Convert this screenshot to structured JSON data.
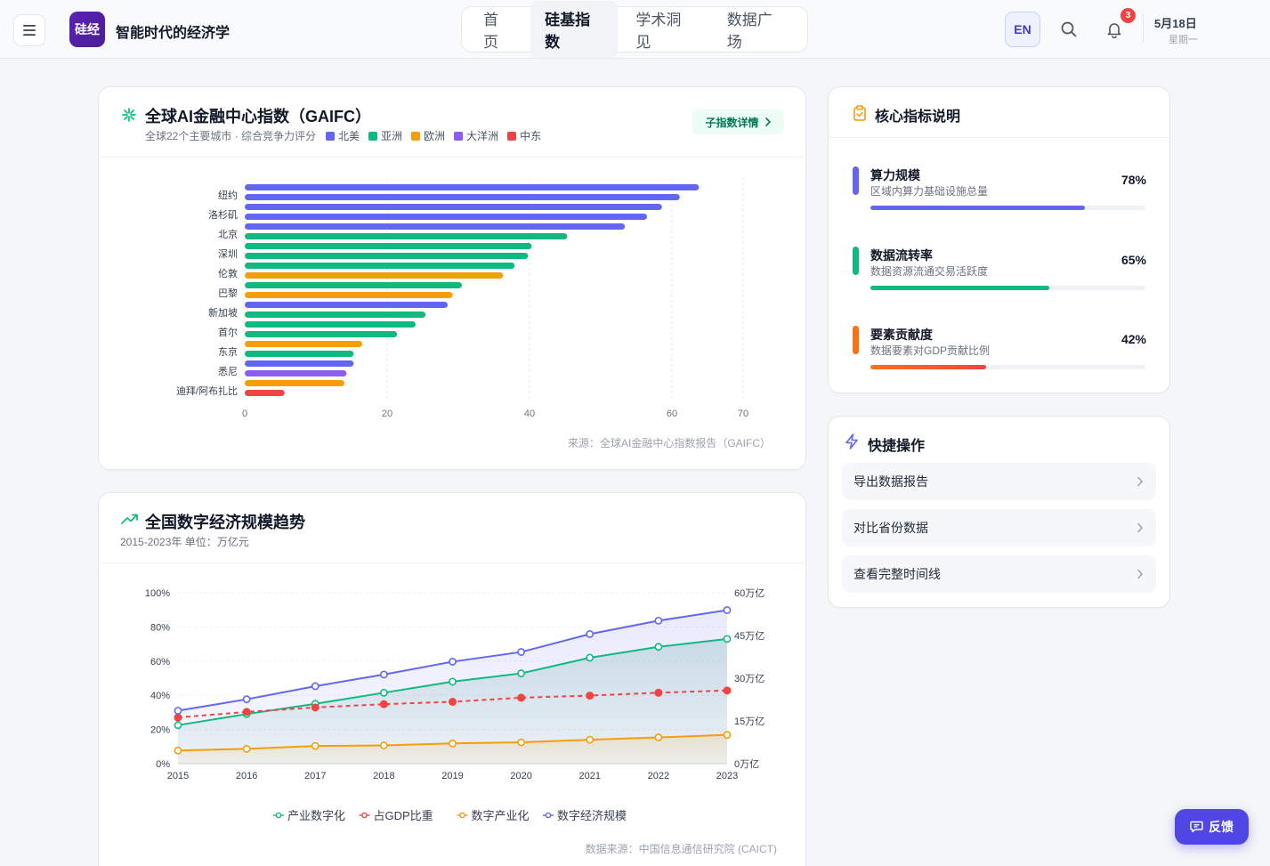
{
  "header": {
    "logo_text": "硅经",
    "site_title": "智能时代的经济学",
    "nav": [
      {
        "label": "首页",
        "active": false
      },
      {
        "label": "硅基指数",
        "active": true
      },
      {
        "label": "学术洞见",
        "active": false
      },
      {
        "label": "数据广场",
        "active": false
      }
    ],
    "lang_label": "EN",
    "notification_count": "3",
    "date": "5月18日",
    "weekday": "星期一"
  },
  "gaifc": {
    "title": "全球AI金融中心指数（GAIFC）",
    "subtitle": "全球22个主要城市 · 综合竞争力评分",
    "detail_button": "子指数详情",
    "source": "来源：全球AI金融中心指数报告（GAIFC）",
    "regions": [
      {
        "name": "北美",
        "color": "#6366f1"
      },
      {
        "name": "亚洲",
        "color": "#10b981"
      },
      {
        "name": "欧洲",
        "color": "#f59e0b"
      },
      {
        "name": "大洋洲",
        "color": "#8b5cf6"
      },
      {
        "name": "中东",
        "color": "#ef4444"
      }
    ]
  },
  "digital": {
    "title": "全国数字经济规模趋势",
    "subtitle": "2015-2023年 单位：万亿元",
    "source": "数据来源：中国信息通信研究院 (CAICT)"
  },
  "chart_data": [
    {
      "type": "bar",
      "orientation": "horizontal",
      "tick_labels_y": [
        "纽约",
        "洛杉矶",
        "北京",
        "深圳",
        "伦敦",
        "巴黎",
        "新加坡",
        "首尔",
        "东京",
        "悉尼",
        "迪拜/阿布扎比"
      ],
      "xlim": [
        0,
        70
      ],
      "xticks": [
        0,
        20,
        40,
        60,
        70
      ],
      "bars": [
        {
          "region": "北美",
          "value": 63.8
        },
        {
          "region": "北美",
          "value": 61.1
        },
        {
          "region": "北美",
          "value": 58.6
        },
        {
          "region": "北美",
          "value": 56.5
        },
        {
          "region": "北美",
          "value": 53.4
        },
        {
          "region": "亚洲",
          "value": 45.3
        },
        {
          "region": "亚洲",
          "value": 40.3
        },
        {
          "region": "亚洲",
          "value": 39.8
        },
        {
          "region": "亚洲",
          "value": 37.9
        },
        {
          "region": "欧洲",
          "value": 36.3
        },
        {
          "region": "亚洲",
          "value": 30.5
        },
        {
          "region": "欧洲",
          "value": 29.2
        },
        {
          "region": "北美",
          "value": 28.5
        },
        {
          "region": "亚洲",
          "value": 25.4
        },
        {
          "region": "亚洲",
          "value": 24.0
        },
        {
          "region": "亚洲",
          "value": 21.4
        },
        {
          "region": "欧洲",
          "value": 16.5
        },
        {
          "region": "亚洲",
          "value": 15.3
        },
        {
          "region": "北美",
          "value": 15.3
        },
        {
          "region": "大洋洲",
          "value": 14.3
        },
        {
          "region": "欧洲",
          "value": 14.0
        },
        {
          "region": "中东",
          "value": 5.6
        }
      ],
      "grid": "vertical dashed"
    },
    {
      "type": "line",
      "x": [
        "2015",
        "2016",
        "2017",
        "2018",
        "2019",
        "2020",
        "2021",
        "2022",
        "2023"
      ],
      "y_left_ticks": [
        "0%",
        "20%",
        "40%",
        "60%",
        "80%",
        "100%"
      ],
      "y_right_ticks": [
        "0万亿",
        "15万亿",
        "30万亿",
        "45万亿",
        "60万亿"
      ],
      "series": [
        {
          "name": "产业数字化",
          "axis": "right",
          "color": "#10b981",
          "values": [
            13.5,
            17.4,
            21.0,
            24.9,
            28.8,
            31.7,
            37.2,
            41.0,
            43.8
          ]
        },
        {
          "name": "占GDP比重",
          "axis": "left",
          "color": "#ef4444",
          "dashed": true,
          "values": [
            27.0,
            30.3,
            32.9,
            34.8,
            36.2,
            38.6,
            39.8,
            41.5,
            42.8
          ]
        },
        {
          "name": "数字产业化",
          "axis": "right",
          "color": "#f59e0b",
          "values": [
            4.6,
            5.2,
            6.2,
            6.4,
            7.1,
            7.5,
            8.4,
            9.2,
            10.1
          ]
        },
        {
          "name": "数字经济规模",
          "axis": "right",
          "color": "#6366f1",
          "values": [
            18.6,
            22.6,
            27.2,
            31.3,
            35.8,
            39.2,
            45.5,
            50.2,
            53.9
          ]
        }
      ],
      "legend": "bottom"
    }
  ],
  "metrics": {
    "title": "核心指标说明",
    "items": [
      {
        "name": "算力规模",
        "desc": "区域内算力基础设施总量",
        "value": "78%",
        "fraction": 0.78,
        "color": "#6366f1"
      },
      {
        "name": "数据流转率",
        "desc": "数据资源流通交易活跃度",
        "value": "65%",
        "fraction": 0.65,
        "color": "#10b981"
      },
      {
        "name": "要素贡献度",
        "desc": "数据要素对GDP贡献比例",
        "value": "42%",
        "fraction": 0.42,
        "color": "#f97316"
      }
    ]
  },
  "quick": {
    "title": "快捷操作",
    "items": [
      "导出数据报告",
      "对比省份数据",
      "查看完整时间线"
    ]
  },
  "feedback_label": "反馈"
}
